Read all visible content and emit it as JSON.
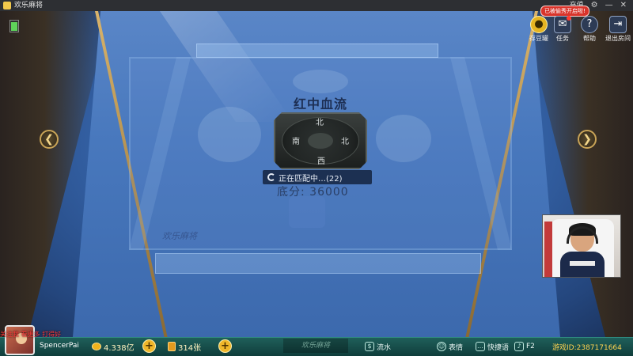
{
  "window": {
    "title": "欢乐麻将",
    "menu_label": "充值"
  },
  "toolbar": {
    "badge_text": "已被偷秀开启啦!",
    "bank_label": "存豆罐",
    "task_label": "任务",
    "help_label": "帮助",
    "exit_label": "退出房间"
  },
  "table": {
    "game_mode": "红中血流",
    "winds": {
      "north": "北",
      "south": "西",
      "east": "北",
      "west": "南"
    },
    "match_status": "正在匹配中…(22)",
    "base_score": "底分: 36000",
    "watermark": "欢乐麻将"
  },
  "bottom_bar": {
    "overlay_text": "关注我 看更多 打得好",
    "player_name": "SpencerPai",
    "gold": "4.338亿",
    "cards": "314张",
    "logo": "欢乐麻将",
    "flow_label": "流水",
    "emote_label": "表情",
    "phrase_label": "快捷语",
    "voice_label": "F2",
    "game_id_label": "游戏ID:",
    "game_id": "2387171664"
  },
  "colors": {
    "felt": "#4878bd",
    "bottom_bar": "#1f5f5a",
    "gold_accent": "#f0b72a",
    "id_text": "#ffd451"
  }
}
